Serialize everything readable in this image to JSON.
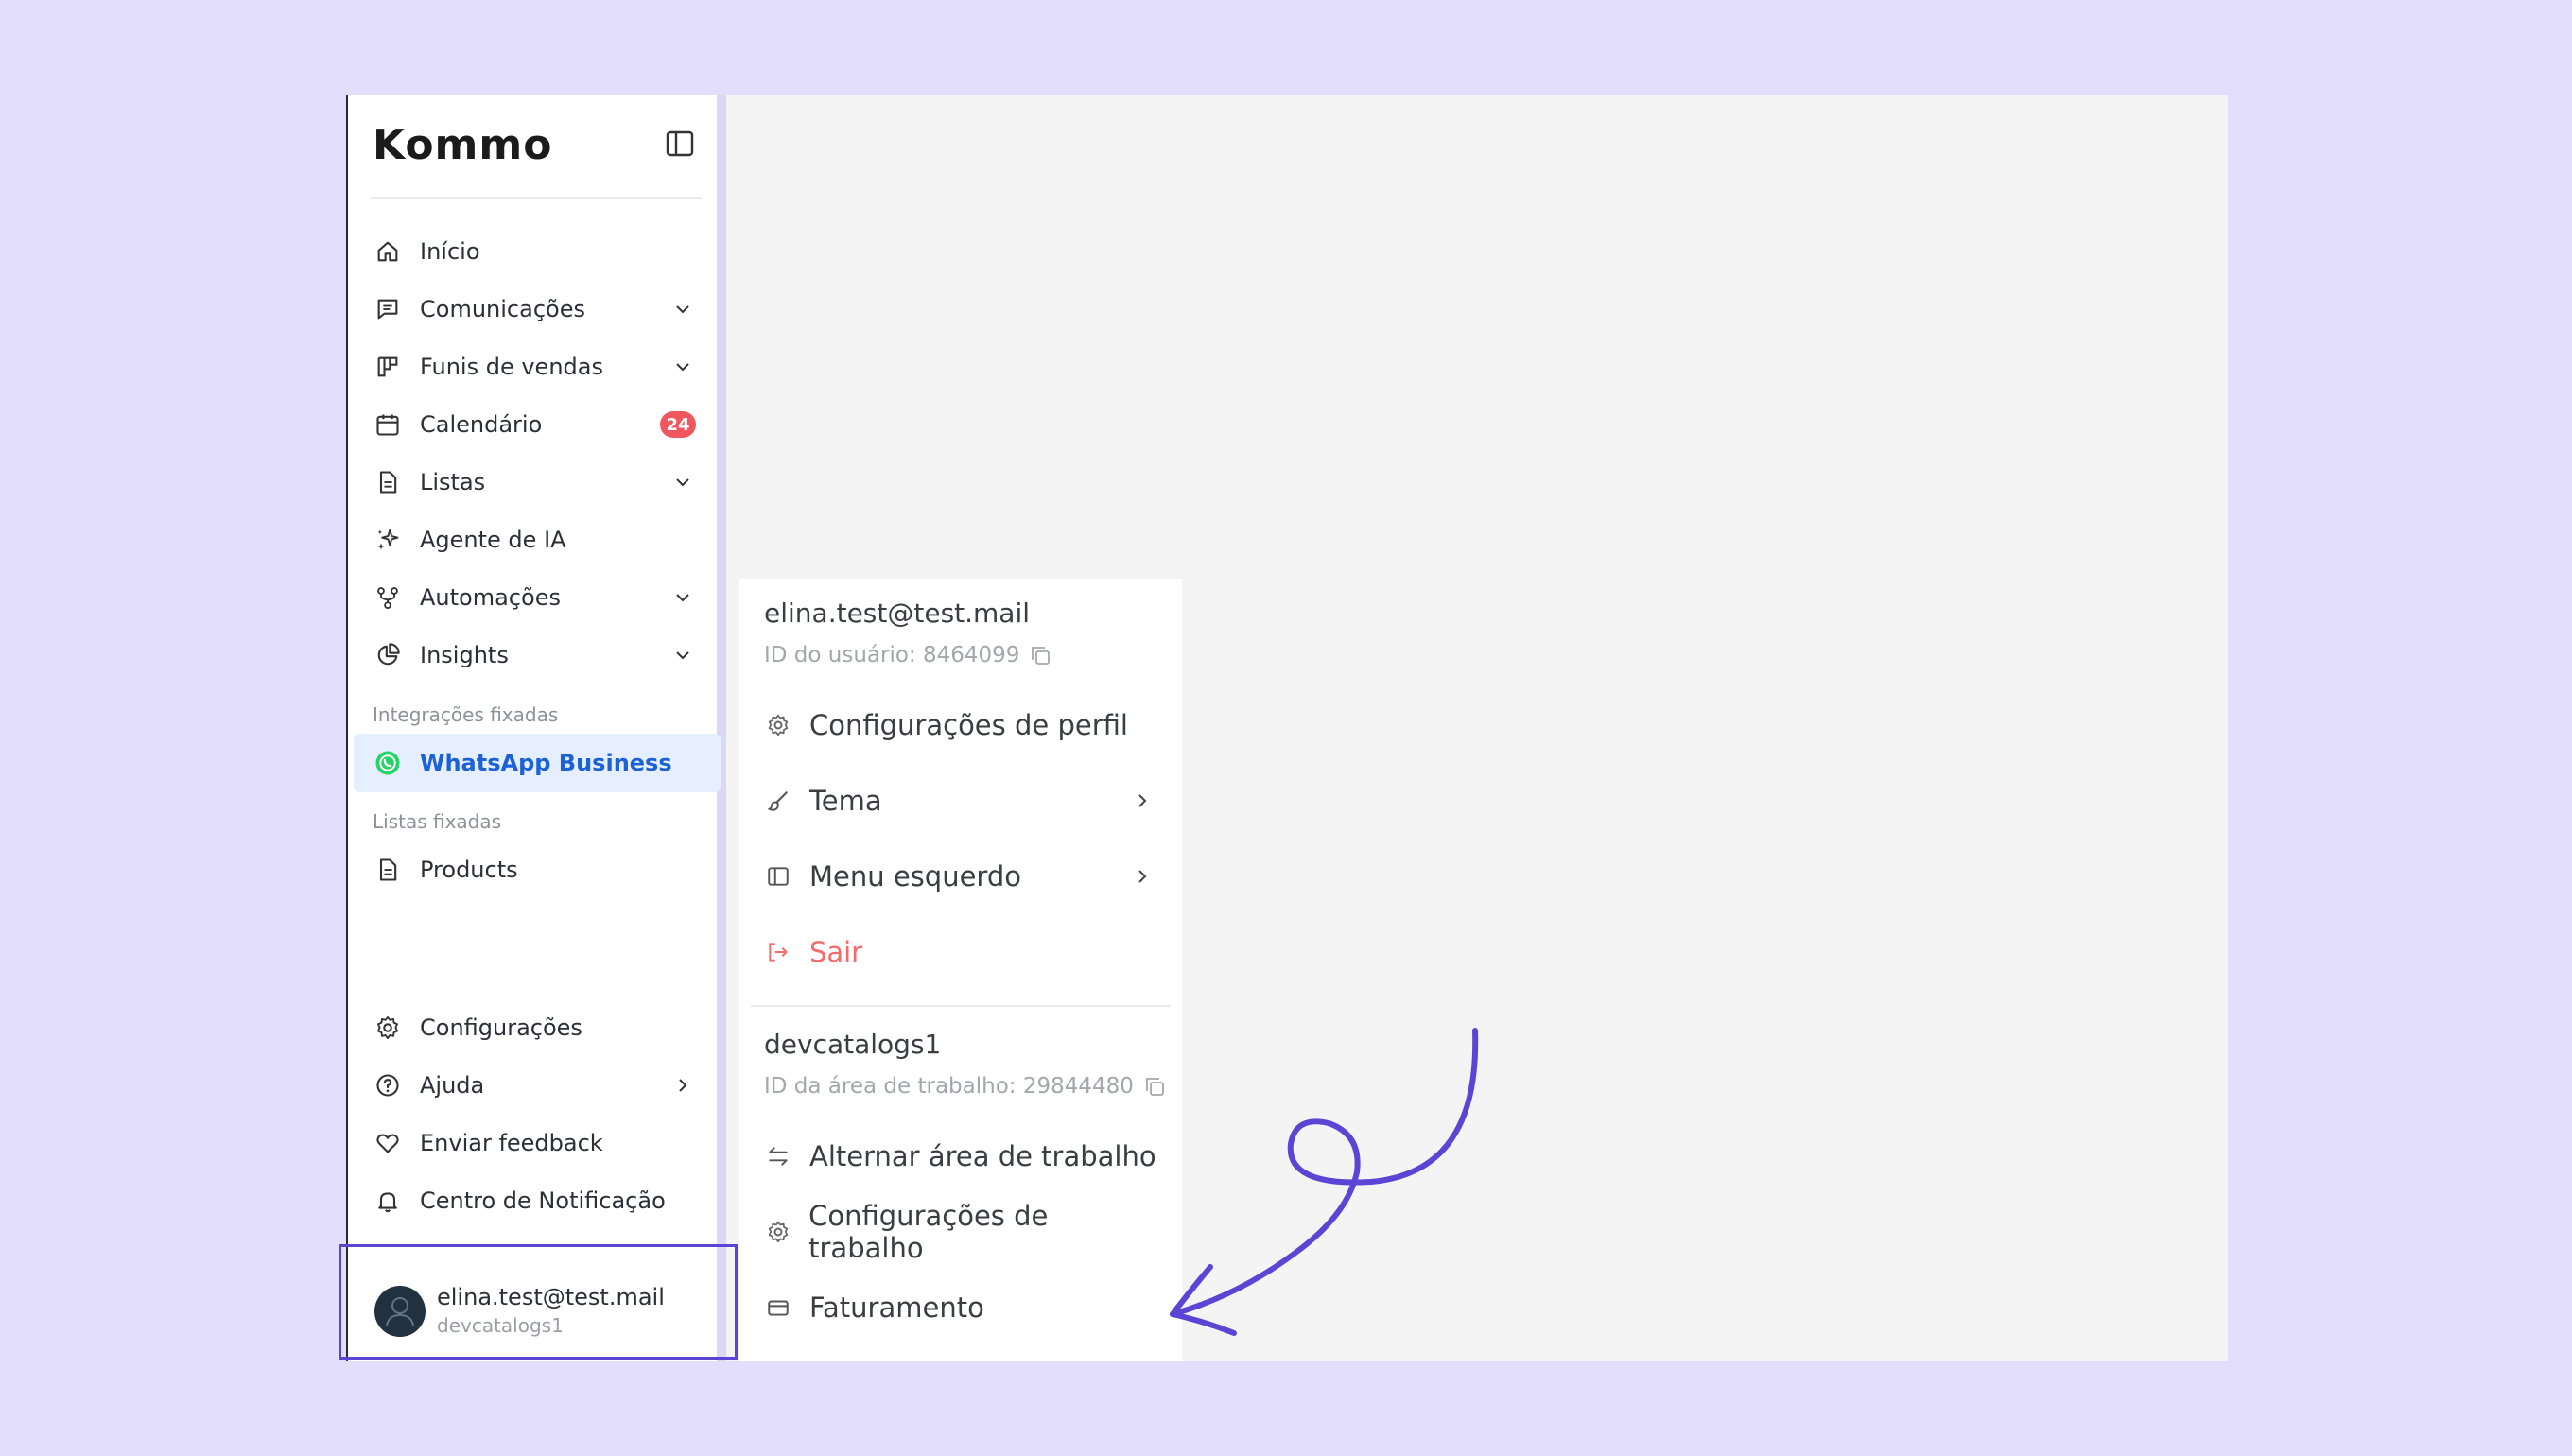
{
  "app": {
    "logo": "Kommo"
  },
  "sidebar": {
    "items": [
      {
        "label": "Início",
        "icon": "home-icon"
      },
      {
        "label": "Comunicações",
        "icon": "chat-icon",
        "chevron": true
      },
      {
        "label": "Funis de vendas",
        "icon": "pipeline-icon",
        "chevron": true
      },
      {
        "label": "Calendário",
        "icon": "calendar-icon",
        "badge": "24"
      },
      {
        "label": "Listas",
        "icon": "document-icon",
        "chevron": true
      },
      {
        "label": "Agente de IA",
        "icon": "sparkles-icon"
      },
      {
        "label": "Automações",
        "icon": "workflow-icon",
        "chevron": true
      },
      {
        "label": "Insights",
        "icon": "pie-chart-icon",
        "chevron": true
      }
    ],
    "pinned_integrations_label": "Integrações fixadas",
    "pinned_integration": {
      "label": "WhatsApp Business",
      "icon": "whatsapp-icon"
    },
    "pinned_lists_label": "Listas fixadas",
    "pinned_list": {
      "label": "Products",
      "icon": "document-icon"
    },
    "bottom_items": [
      {
        "label": "Configurações",
        "icon": "gear-icon"
      },
      {
        "label": "Ajuda",
        "icon": "help-icon",
        "chevron_right": true
      },
      {
        "label": "Enviar feedback",
        "icon": "heart-icon"
      },
      {
        "label": "Centro de Notificação",
        "icon": "bell-icon"
      }
    ],
    "user": {
      "email": "elina.test@test.mail",
      "workspace": "devcatalogs1"
    }
  },
  "profile_menu": {
    "email": "elina.test@test.mail",
    "user_id": "ID do usuário: 8464099",
    "items": [
      {
        "label": "Configurações de perfil",
        "icon": "gear-icon"
      },
      {
        "label": "Tema",
        "icon": "brush-icon",
        "chevron": true
      },
      {
        "label": "Menu esquerdo",
        "icon": "sidebar-icon",
        "chevron": true
      },
      {
        "label": "Sair",
        "icon": "logout-icon",
        "color": "#f36b6b"
      }
    ],
    "workspace_name": "devcatalogs1",
    "workspace_id": "ID da área de trabalho: 29844480",
    "workspace_items": [
      {
        "label": "Alternar área de trabalho",
        "icon": "switch-icon"
      },
      {
        "label": "Configurações de trabalho",
        "icon": "gear-icon"
      },
      {
        "label": "Faturamento",
        "icon": "credit-card-icon"
      }
    ]
  },
  "colors": {
    "background": "#e4defd",
    "accent": "#5c45d4",
    "active": "#1c62d6",
    "badge": "#f0565d"
  }
}
